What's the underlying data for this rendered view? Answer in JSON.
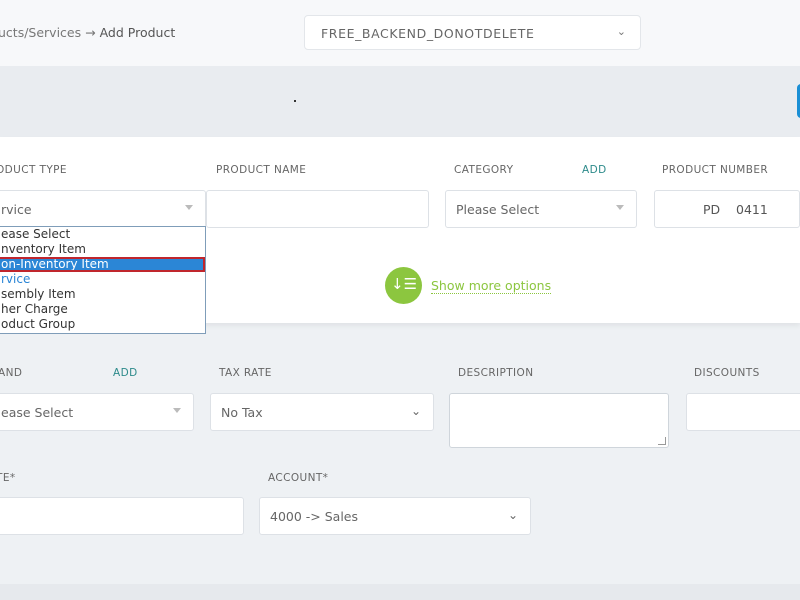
{
  "breadcrumb": {
    "parent": "ucts/Services",
    "arrow": "→",
    "current": "Add Product"
  },
  "company_select": {
    "value": "FREE_BACKEND_DONOTDELETE",
    "chevron": "⌄"
  },
  "form": {
    "product_type": {
      "label": "ODUCT TYPE",
      "value": "rvice"
    },
    "product_name": {
      "label": "PRODUCT NAME",
      "value": ""
    },
    "category": {
      "label": "CATEGORY",
      "add": "ADD",
      "value": "Please Select"
    },
    "product_number": {
      "label": "PRODUCT NUMBER",
      "prefix": "PD",
      "number": "0411"
    },
    "show_more": "Show more options",
    "brand": {
      "label": "AND",
      "add": "ADD",
      "value": "ease Select"
    },
    "tax_rate": {
      "label": "TAX RATE",
      "value": "No Tax"
    },
    "description": {
      "label": "DESCRIPTION",
      "value": ""
    },
    "discounts": {
      "label": "DISCOUNTS",
      "value": ""
    },
    "rate": {
      "label": "TE*",
      "value": ""
    },
    "account": {
      "label": "ACCOUNT*",
      "value": "4000 -> Sales"
    }
  },
  "dropdown": {
    "options": [
      "ease Select",
      "nventory Item",
      "on-Inventory Item",
      "rvice",
      "sembly Item",
      "her Charge",
      "oduct Group"
    ],
    "selected_index": 2
  },
  "colors": {
    "accent_green": "#8cc63f",
    "highlight_blue": "#2b86d6",
    "add_link": "#2c8a8a"
  }
}
